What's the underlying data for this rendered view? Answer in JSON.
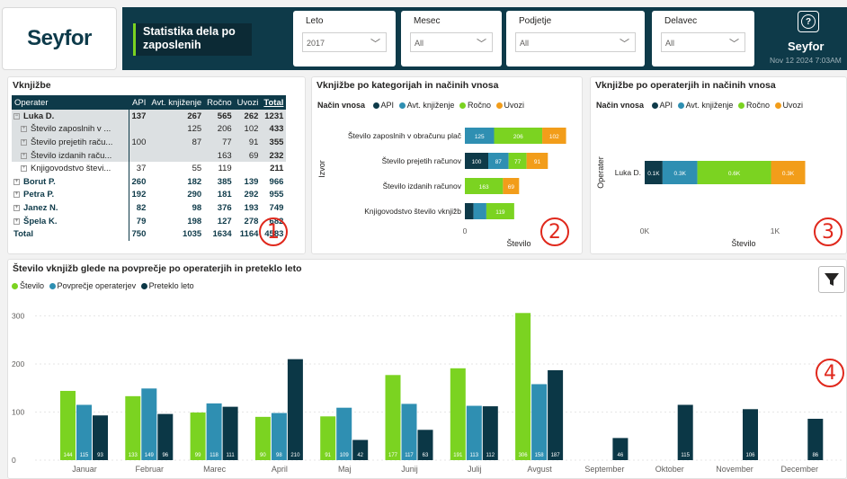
{
  "header": {
    "logo": "Seyfor",
    "title": "Statistika dela po zaposlenih",
    "brand": "Seyfor",
    "date": "Nov 12 2024 7:03AM",
    "help_icon": "question-icon"
  },
  "slicers": [
    {
      "label": "Leto",
      "value": "2017"
    },
    {
      "label": "Mesec",
      "value": "All"
    },
    {
      "label": "Podjetje",
      "value": "All"
    },
    {
      "label": "Delavec",
      "value": "All"
    }
  ],
  "colors": {
    "api": "#0e3a49",
    "avt": "#2f8fb2",
    "rocno": "#7bd321",
    "uvozi": "#f29d1a",
    "stevilo": "#7bd321",
    "povprecje": "#2f8fb2",
    "preteklo": "#0b3746",
    "header": "#0e3a49",
    "badge": "#e0281c"
  },
  "table": {
    "title": "Vknjižbe",
    "columns": [
      "Operater",
      "API",
      "Avt. knjiženje",
      "Ročno",
      "Uvozi",
      "Total"
    ],
    "rows": [
      {
        "name": "Luka D.",
        "api": "137",
        "avt": "267",
        "rocno": "565",
        "uvozi": "262",
        "total": "1231",
        "kind": "luka",
        "sign": "⊟"
      },
      {
        "name": "Število zaposlnih v ...",
        "api": "",
        "avt": "125",
        "rocno": "206",
        "uvozi": "102",
        "total": "433",
        "kind": "sub",
        "sign": "⊞"
      },
      {
        "name": "Število prejetih raču...",
        "api": "100",
        "avt": "87",
        "rocno": "77",
        "uvozi": "91",
        "total": "355",
        "kind": "sub",
        "sign": "⊞"
      },
      {
        "name": "Število izdanih raču...",
        "api": "",
        "avt": "",
        "rocno": "163",
        "uvozi": "69",
        "total": "232",
        "kind": "sub",
        "sign": "⊞"
      },
      {
        "name": "Knjigovodstvo števi...",
        "api": "37",
        "avt": "55",
        "rocno": "119",
        "uvozi": "",
        "total": "211",
        "kind": "sub2",
        "sign": "⊞"
      },
      {
        "name": "Borut P.",
        "api": "260",
        "avt": "182",
        "rocno": "385",
        "uvozi": "139",
        "total": "966",
        "kind": "l1",
        "sign": "⊞"
      },
      {
        "name": "Petra P.",
        "api": "192",
        "avt": "290",
        "rocno": "181",
        "uvozi": "292",
        "total": "955",
        "kind": "l1",
        "sign": "⊞"
      },
      {
        "name": "Janez N.",
        "api": "82",
        "avt": "98",
        "rocno": "376",
        "uvozi": "193",
        "total": "749",
        "kind": "l1",
        "sign": "⊞"
      },
      {
        "name": "Špela K.",
        "api": "79",
        "avt": "198",
        "rocno": "127",
        "uvozi": "278",
        "total": "682",
        "kind": "l1",
        "sign": "⊞"
      },
      {
        "name": "Total",
        "api": "750",
        "avt": "1035",
        "rocno": "1634",
        "uvozi": "1164",
        "total": "4583",
        "kind": "total",
        "sign": ""
      }
    ]
  },
  "badges": [
    "1",
    "2",
    "3",
    "4"
  ],
  "chart_data": [
    {
      "type": "bar",
      "orientation": "horizontal-stacked",
      "title": "Vknjižbe po kategorijah in načinih vnosa",
      "legend_title": "Način vnosa",
      "legend": [
        "API",
        "Avt. knjiženje",
        "Ročno",
        "Uvozi"
      ],
      "ylabel": "Izvor",
      "xlabel": "Število",
      "x_ticks": [
        "0"
      ],
      "categories": [
        "Število zaposlnih v obračunu plač",
        "Število prejetih računov",
        "Število izdanih računov",
        "Knjigovodstvo število vknjižb"
      ],
      "series": [
        {
          "name": "API",
          "values": [
            0,
            100,
            0,
            37
          ]
        },
        {
          "name": "Avt. knjiženje",
          "values": [
            125,
            87,
            0,
            55
          ]
        },
        {
          "name": "Ročno",
          "values": [
            206,
            77,
            163,
            119
          ]
        },
        {
          "name": "Uvozi",
          "values": [
            102,
            91,
            69,
            0
          ]
        }
      ],
      "labels": [
        [
          "",
          "125",
          "206",
          "102"
        ],
        [
          "100",
          "87",
          "77",
          "91"
        ],
        [
          "",
          "",
          "163",
          "69"
        ],
        [
          "",
          "",
          "119",
          ""
        ]
      ]
    },
    {
      "type": "bar",
      "orientation": "horizontal-stacked",
      "title": "Vknjižbe po operaterjih in načinih vnosa",
      "legend_title": "Način vnosa",
      "legend": [
        "API",
        "Avt. knjiženje",
        "Ročno",
        "Uvozi"
      ],
      "ylabel": "Operater",
      "xlabel": "Število",
      "x_ticks": [
        "0K",
        "1K"
      ],
      "categories": [
        "Luka D."
      ],
      "series": [
        {
          "name": "API",
          "values": [
            137
          ]
        },
        {
          "name": "Avt. knjiženje",
          "values": [
            267
          ]
        },
        {
          "name": "Ročno",
          "values": [
            565
          ]
        },
        {
          "name": "Uvozi",
          "values": [
            262
          ]
        }
      ],
      "labels": [
        [
          "0.1K",
          "0.3K",
          "0.6K",
          "0.3K"
        ]
      ]
    },
    {
      "type": "bar",
      "title": "Število vknjižb glede na povprečje po operaterjih in preteklo leto",
      "legend": [
        "Število",
        "Povprečje operaterjev",
        "Preteklo leto"
      ],
      "y_ticks": [
        "0",
        "100",
        "200",
        "300"
      ],
      "ylim": [
        0,
        320
      ],
      "categories": [
        "Januar",
        "Februar",
        "Marec",
        "April",
        "Maj",
        "Junij",
        "Julij",
        "Avgust",
        "September",
        "Oktober",
        "November",
        "December"
      ],
      "series": [
        {
          "name": "Število",
          "values": [
            144,
            133,
            99,
            90,
            91,
            177,
            191,
            306,
            null,
            null,
            null,
            null
          ]
        },
        {
          "name": "Povprečje operaterjev",
          "values": [
            115,
            149,
            118,
            98,
            109,
            117,
            113,
            158,
            null,
            null,
            null,
            null
          ]
        },
        {
          "name": "Preteklo leto",
          "values": [
            93,
            96,
            111,
            210,
            42,
            63,
            112,
            187,
            46,
            115,
            106,
            86
          ]
        }
      ]
    }
  ]
}
